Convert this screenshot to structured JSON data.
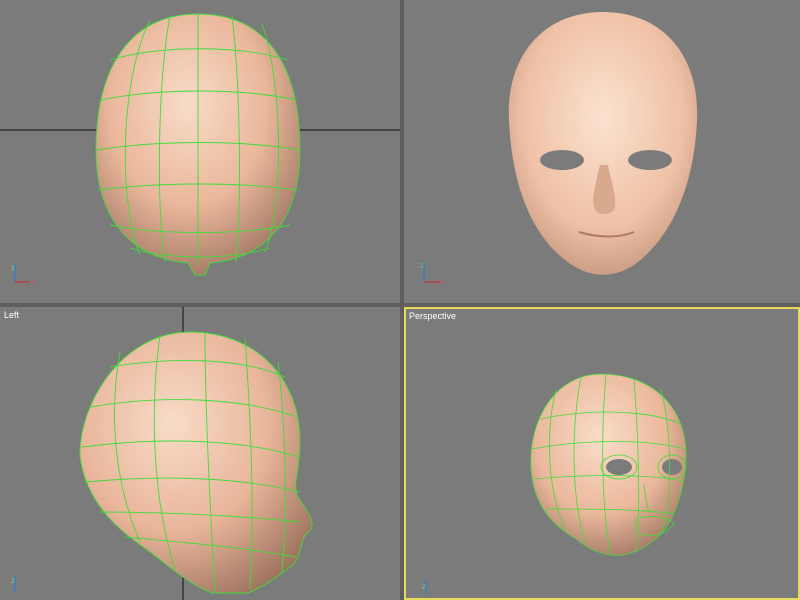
{
  "viewports": {
    "top_left": {
      "label": "",
      "active": false
    },
    "top_right": {
      "label": "",
      "active": false
    },
    "bottom_left": {
      "label": "Left",
      "active": false
    },
    "bottom_right": {
      "label": "Perspective",
      "active": true
    }
  },
  "axis_labels": {
    "x": "x",
    "z": "z"
  },
  "colors": {
    "viewport_bg": "#7b7b7b",
    "active_border": "#e6dc5a",
    "skin": "#f2c7ad",
    "wire": "#3fdc3a",
    "crosshair": "#111111"
  }
}
